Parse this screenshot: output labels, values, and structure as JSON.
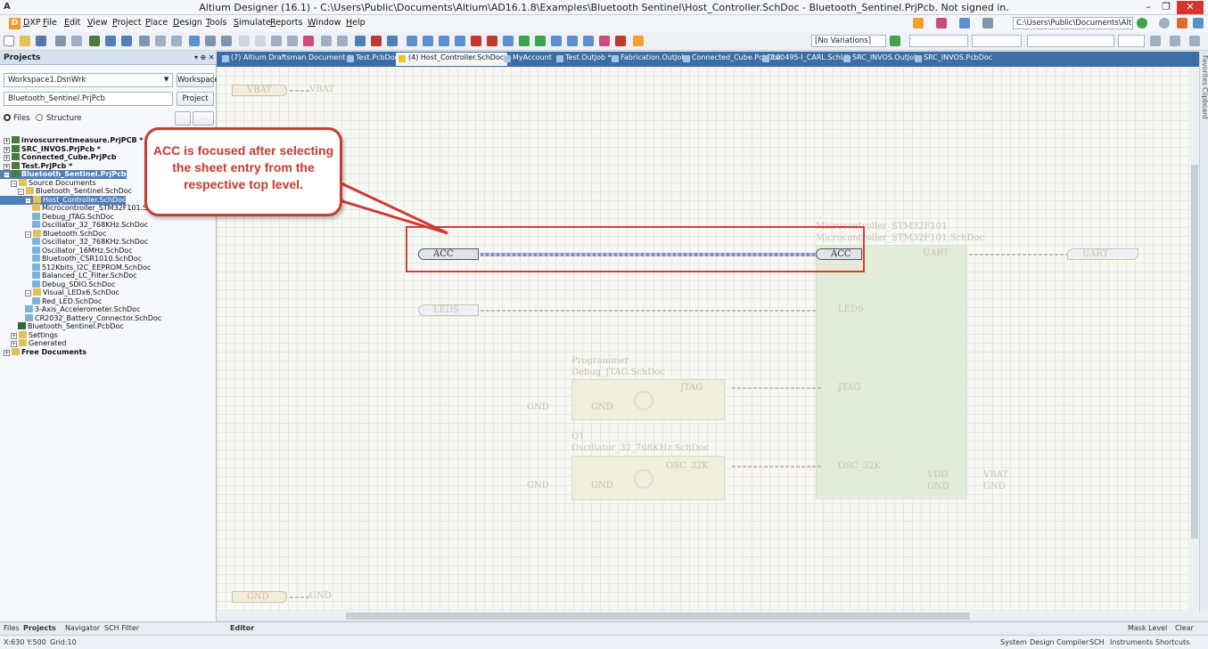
{
  "window": {
    "title": "Altium Designer (16.1) - C:\\Users\\Public\\Documents\\Altium\\AD16.1.8\\Examples\\Bluetooth Sentinel\\Host_Controller.SchDoc - Bluetooth_Sentinel.PrjPcb. Not signed in.",
    "minimize": "–",
    "restore": "❐",
    "close": "✕"
  },
  "menu": {
    "dxp": "DXP",
    "items": [
      "File",
      "Edit",
      "View",
      "Project",
      "Place",
      "Design",
      "Tools",
      "Simulate",
      "Reports",
      "Window",
      "Help"
    ]
  },
  "path_combo": "C:\\Users\\Public\\Documents\\Altiur",
  "variations": "[No Variations]",
  "tabs": [
    "(7) Altium Draftsman Document *",
    "Test.PcbDoc",
    "(4) Host_Controller.SchDoc",
    "MyAccount",
    "Test.OutJob *",
    "Fabrication.OutJob",
    "Connected_Cube.PcbDoc",
    "100495-I_CARL.SchLib",
    "SRC_INVOS.OutJob",
    "SRC_INVOS.PcbDoc"
  ],
  "panel": {
    "title": "Projects",
    "workspace": "Workspace1.DsnWrk",
    "workspace_btn": "Workspace",
    "project": "Bluetooth_Sentinel.PrjPcb",
    "project_btn": "Project",
    "radio_files": "Files",
    "radio_structure": "Structure"
  },
  "tree": [
    {
      "label": "invoscurrentmeasure.PrjPCB *",
      "indent": 0,
      "icon": "proj",
      "bold": true,
      "pm": "+"
    },
    {
      "label": "SRC_INVOS.PrjPcb *",
      "indent": 0,
      "icon": "proj",
      "bold": true,
      "pm": "+"
    },
    {
      "label": "Connected_Cube.PrjPcb",
      "indent": 0,
      "icon": "proj",
      "bold": true,
      "pm": "+"
    },
    {
      "label": "Test.PrjPcb *",
      "indent": 0,
      "icon": "proj",
      "bold": true,
      "pm": "+"
    },
    {
      "label": "Bluetooth_Sentinel.PrjPcb",
      "indent": 0,
      "icon": "proj",
      "bold": true,
      "pm": "−",
      "sel": true
    },
    {
      "label": "Source Documents",
      "indent": 1,
      "icon": "fold",
      "pm": "−"
    },
    {
      "label": "Bluetooth_Sentinel.SchDoc",
      "indent": 2,
      "icon": "fold",
      "pm": "−"
    },
    {
      "label": "Host_Controller.SchDoc",
      "indent": 3,
      "icon": "fold",
      "pm": "−",
      "sel": true
    },
    {
      "label": "Microcontroller_STM32F101.SchDoc",
      "indent": 4,
      "icon": "fold"
    },
    {
      "label": "Debug_JTAG.SchDoc",
      "indent": 4,
      "icon": "doc"
    },
    {
      "label": "Oscillator_32_768KHz.SchDoc",
      "indent": 4,
      "icon": "doc"
    },
    {
      "label": "Bluetooth.SchDoc",
      "indent": 3,
      "icon": "fold",
      "pm": "−"
    },
    {
      "label": "Oscillator_32_768KHz.SchDoc",
      "indent": 4,
      "icon": "doc"
    },
    {
      "label": "Oscillator_16MHz.SchDoc",
      "indent": 4,
      "icon": "doc"
    },
    {
      "label": "Bluetooth_CSR1010.SchDoc",
      "indent": 4,
      "icon": "doc"
    },
    {
      "label": "512Kbits_I2C_EEPROM.SchDoc",
      "indent": 4,
      "icon": "doc"
    },
    {
      "label": "Balanced_LC_Filter.SchDoc",
      "indent": 4,
      "icon": "doc"
    },
    {
      "label": "Debug_SDIO.SchDoc",
      "indent": 4,
      "icon": "doc"
    },
    {
      "label": "Visual_LEDx6.SchDoc",
      "indent": 3,
      "icon": "fold",
      "pm": "−"
    },
    {
      "label": "Red_LED.SchDoc",
      "indent": 4,
      "icon": "doc"
    },
    {
      "label": "3-Axis_Accelerometer.SchDoc",
      "indent": 3,
      "icon": "doc"
    },
    {
      "label": "CR2032_Battery_Connector.SchDoc",
      "indent": 3,
      "icon": "doc"
    },
    {
      "label": "Bluetooth_Sentinel.PcbDoc",
      "indent": 2,
      "icon": "pcb"
    },
    {
      "label": "Settings",
      "indent": 1,
      "icon": "fold",
      "pm": "+"
    },
    {
      "label": "Generated",
      "indent": 1,
      "icon": "fold",
      "pm": "+"
    },
    {
      "label": "Free Documents",
      "indent": 0,
      "icon": "fold",
      "pm": "+",
      "bold": true
    }
  ],
  "callout": "ACC is focused after selecting the sheet entry from the respective top level.",
  "schematic": {
    "vbat_top": "VBAT",
    "vbat_net": "VBAT",
    "acc_port": "ACC",
    "acc_entry": "ACC",
    "leds_port": "LEDS",
    "leds_entry": "LEDS",
    "mcu_designator": "Microcontroller_STM32F101",
    "mcu_file": "Microcontroller_STM32F101.SchDoc",
    "uart_entry": "UART",
    "uart_port": "UART",
    "prog_designator": "Programmer",
    "prog_file": "Debug_JTAG.SchDoc",
    "jtag_entry": "JTAG",
    "jtag_target": "JTAG",
    "gnd_entry1": "GND",
    "gnd_net1": "GND",
    "q1_designator": "Q1",
    "q1_file": "Oscillator_32_768KHz.SchDoc",
    "osc_entry": "OSC_32K",
    "osc_target": "OSC_32K",
    "gnd_entry2": "GND",
    "gnd_net2": "GND",
    "vdd_entry": "VDD",
    "gnd_entry3": "GND",
    "vbat_out": "VBAT",
    "gnd_out": "GND",
    "gnd_bottom": "GND",
    "gnd_bottom_net": "GND"
  },
  "side_tabs": [
    "Favorites",
    "Clipboard"
  ],
  "bottom_tabs": [
    "Files",
    "Projects",
    "Navigator",
    "SCH Filter"
  ],
  "editor_label": "Editor",
  "mask": "Mask Level",
  "clear": "Clear",
  "status": {
    "coords": "X:630 Y:500",
    "grid": "Grid:10"
  },
  "status_right": [
    "System",
    "Design Compiler",
    "SCH",
    "Instruments",
    "Shortcuts"
  ]
}
